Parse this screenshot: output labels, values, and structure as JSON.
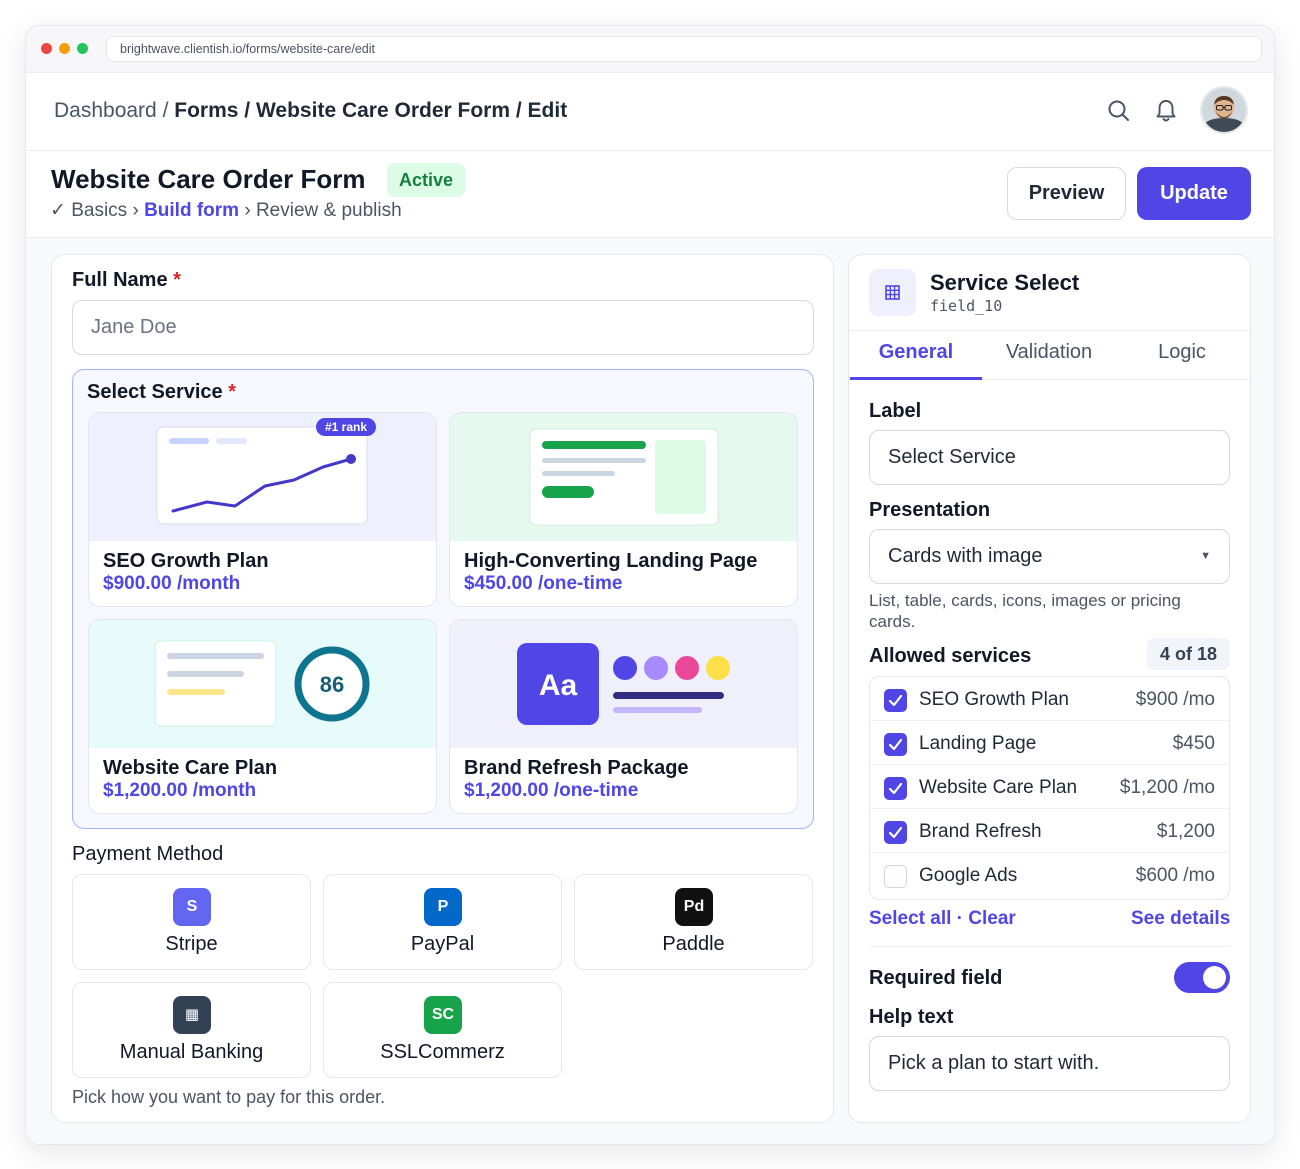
{
  "browser": {
    "url": "brightwave.clientish.io/forms/website-care/edit"
  },
  "breadcrumb": {
    "dashboard": "Dashboard",
    "sep": "/",
    "forms": "Forms",
    "form": "Website Care Order Form",
    "edit": "Edit"
  },
  "header": {
    "title": "Website Care Order Form",
    "status": "Active",
    "steps": {
      "basics": "Basics",
      "build": "Build form",
      "review": "Review & publish"
    },
    "preview_label": "Preview",
    "update_label": "Update"
  },
  "form": {
    "full_name": {
      "label": "Full Name",
      "required": "*",
      "placeholder": "Jane Doe"
    },
    "select_service": {
      "label": "Select Service",
      "required": "*",
      "cards": [
        {
          "name": "SEO Growth Plan",
          "price": "$900.00 /month",
          "badge": "#1 rank"
        },
        {
          "name": "High-Converting Landing Page",
          "price": "$450.00 /one-time"
        },
        {
          "name": "Website Care Plan",
          "price": "$1,200.00 /month",
          "score": "86"
        },
        {
          "name": "Brand Refresh Package",
          "price": "$1,200.00 /one-time",
          "glyph": "Aa"
        }
      ]
    },
    "payment": {
      "label": "Payment Method",
      "methods": [
        {
          "name": "Stripe",
          "icon_text": "S",
          "color": "#6366f1"
        },
        {
          "name": "PayPal",
          "icon_text": "P",
          "color": "#0369c9"
        },
        {
          "name": "Paddle",
          "icon_text": "Pd",
          "color": "#111111"
        },
        {
          "name": "Manual Banking",
          "icon_text": "▦",
          "color": "#334155"
        },
        {
          "name": "SSLCommerz",
          "icon_text": "SC",
          "color": "#16a34a"
        }
      ],
      "hint": "Pick how you want to pay for this order."
    }
  },
  "inspector": {
    "title": "Service Select",
    "field_id": "field_10",
    "icon": "grid-icon",
    "tabs": [
      "General",
      "Validation",
      "Logic"
    ],
    "active_tab": "General",
    "label_caption": "Label",
    "label_value": "Select Service",
    "presentation_caption": "Presentation",
    "presentation_value": "Cards with image",
    "presentation_help": "List, table, cards, icons, images or pricing cards.",
    "allowed_caption": "Allowed services",
    "allowed_count": "4 of 18",
    "allowed": [
      {
        "name": "SEO Growth Plan",
        "price": "$900 /mo",
        "checked": true
      },
      {
        "name": "Landing Page",
        "price": "$450",
        "checked": true
      },
      {
        "name": "Website Care Plan",
        "price": "$1,200 /mo",
        "checked": true
      },
      {
        "name": "Brand Refresh",
        "price": "$1,200",
        "checked": true
      },
      {
        "name": "Google Ads",
        "price": "$600 /mo",
        "checked": false
      }
    ],
    "select_all": "Select all",
    "clear": "Clear",
    "see_details": "See details",
    "required_caption": "Required field",
    "required_on": true,
    "help_caption": "Help text",
    "help_value": "Pick a plan to start with."
  },
  "colors": {
    "accent": "#4f46e5",
    "active_bg": "#dcfce7",
    "active_text": "#15803d",
    "required": "#dc2626"
  }
}
